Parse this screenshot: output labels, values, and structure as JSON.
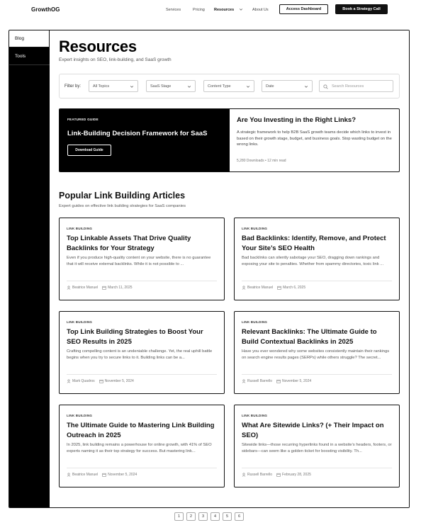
{
  "header": {
    "logo": "GrowthOG",
    "nav": [
      "Services",
      "Pricing",
      "Resources",
      "About Us"
    ],
    "access_dashboard": "Access Dashboard",
    "book_call": "Book a Strategy Call"
  },
  "sidebar": {
    "items": [
      "Blog",
      "Tools"
    ]
  },
  "page": {
    "title": "Resources",
    "subtitle": "Expert insights on SEO, link-building, and SaaS growth"
  },
  "filters": {
    "label": "Filter by:",
    "topics": "All Topics",
    "stage": "SaaS Stage",
    "type": "Content Type",
    "date": "Date",
    "search_placeholder": "Search Resources"
  },
  "featured": {
    "tag": "FEATURED GUIDE",
    "title": "Link-Building Decision Framework for SaaS",
    "button": "Download Guide",
    "heading": "Are You Investing in the Right Links?",
    "description": "A strategic framework to help B2B SaaS growth teams decide which links to invest in based on their growth stage, budget, and business goals. Stop wasting budget on the wrong links.",
    "meta": "5,280 Downloads • 12 min read"
  },
  "section": {
    "title": "Popular Link Building Articles",
    "subtitle": "Expert guides on effective link building strategies for SaaS companies"
  },
  "articles": [
    {
      "tag": "LINK BUILDING",
      "title": "Top Linkable Assets That Drive Quality Backlinks for Your Strategy",
      "excerpt": "Even if you produce high-quality content on your website, there is no guarantee that it will receive external backlinks. While it is not possible to ...",
      "author": "Beatrice Manuel",
      "date": "March 11, 2025"
    },
    {
      "tag": "LINK BUILDING",
      "title": "Bad Backlinks: Identify, Remove, and Protect Your Site’s SEO Health",
      "excerpt": "Bad backlinks can silently sabotage your SEO, dragging down rankings and exposing your site to penalties. Whether from spammy directories, toxic link ...",
      "author": "Beatrice Manuel",
      "date": "March 6, 2025"
    },
    {
      "tag": "LINK BUILDING",
      "title": "Top Link Building Strategies to Boost Your SEO Results in 2025",
      "excerpt": "Crafting compelling content is an undeniable challenge. Yet, the real uphill battle begins when you try to secure links to it. Building links can be a...",
      "author": "Mark Quadros",
      "date": "November 5, 2024"
    },
    {
      "tag": "LINK BUILDING",
      "title": "Relevant Backlinks: The Ultimate Guide to Build Contextual Backlinks in 2025",
      "excerpt": "Have you ever wondered why some websites consistently maintain their rankings on search engine results pages (SERPs) while others struggle? The secret...",
      "author": "Russell Barrello",
      "date": "November 5, 2024"
    },
    {
      "tag": "LINK BUILDING",
      "title": "The Ultimate Guide to Mastering Link Building Outreach in 2025",
      "excerpt": "In 2025, link building remains a powerhouse for online growth, with 41% of SEO experts naming it as their top strategy for success. But mastering link...",
      "author": "Beatrice Manuel",
      "date": "November 5, 2024"
    },
    {
      "tag": "LINK BUILDING",
      "title": "What Are Sitewide Links? (+ Their Impact on SEO)",
      "excerpt": "Sitewide links—those recurring hyperlinks found in a website’s headers, footers, or sidebars—can seem like a golden ticket for boosting visibility. Th...",
      "author": "Russell Barrello",
      "date": "February 28, 2025"
    }
  ],
  "pagination": [
    "1",
    "2",
    "3",
    "4",
    "5",
    "6"
  ]
}
